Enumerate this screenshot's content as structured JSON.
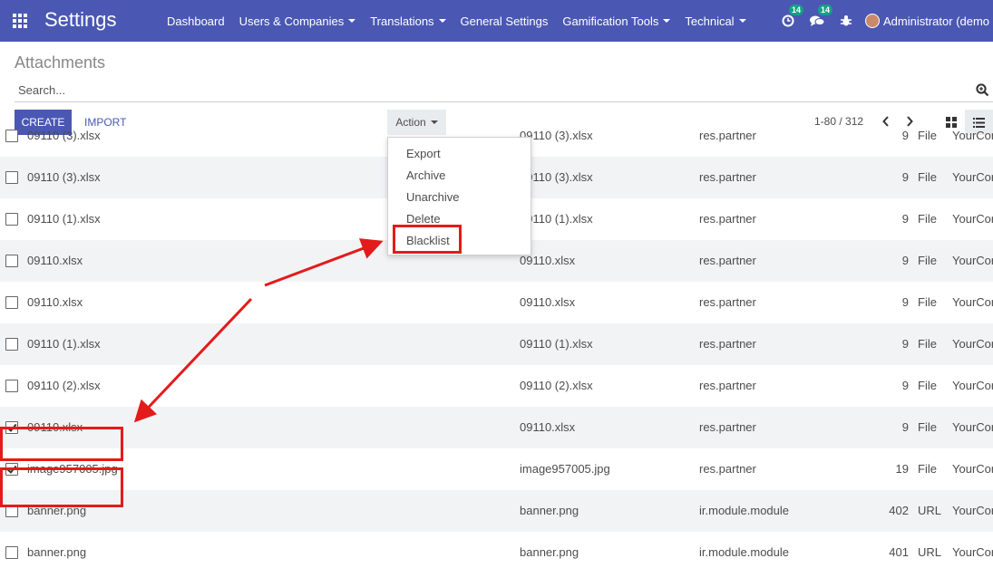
{
  "navbar": {
    "brand": "Settings",
    "menu": [
      {
        "label": "Dashboard",
        "has_caret": false
      },
      {
        "label": "Users & Companies",
        "has_caret": true
      },
      {
        "label": "Translations",
        "has_caret": true
      },
      {
        "label": "General Settings",
        "has_caret": false
      },
      {
        "label": "Gamification Tools",
        "has_caret": true
      },
      {
        "label": "Technical",
        "has_caret": true
      }
    ],
    "activity_badge": "14",
    "messages_badge": "14",
    "user": "Administrator (demo"
  },
  "control_panel": {
    "breadcrumb": "Attachments",
    "search_placeholder": "Search...",
    "create_label": "CREATE",
    "import_label": "IMPORT",
    "action_label": "Action",
    "pager": "1-80 / 312"
  },
  "action_menu": [
    "Export",
    "Archive",
    "Unarchive",
    "Delete",
    "Blacklist"
  ],
  "rows": [
    {
      "name": "09110 (3).xlsx",
      "fname": "09110 (3).xlsx",
      "model": "res.partner",
      "size": "9",
      "type": "File",
      "company": "YourCor",
      "checked": false
    },
    {
      "name": "09110 (3).xlsx",
      "fname": "09110 (3).xlsx",
      "model": "res.partner",
      "size": "9",
      "type": "File",
      "company": "YourCor",
      "checked": false
    },
    {
      "name": "09110 (1).xlsx",
      "fname": "09110 (1).xlsx",
      "model": "res.partner",
      "size": "9",
      "type": "File",
      "company": "YourCor",
      "checked": false
    },
    {
      "name": "09110.xlsx",
      "fname": "09110.xlsx",
      "model": "res.partner",
      "size": "9",
      "type": "File",
      "company": "YourCor",
      "checked": false
    },
    {
      "name": "09110.xlsx",
      "fname": "09110.xlsx",
      "model": "res.partner",
      "size": "9",
      "type": "File",
      "company": "YourCor",
      "checked": false
    },
    {
      "name": "09110 (1).xlsx",
      "fname": "09110 (1).xlsx",
      "model": "res.partner",
      "size": "9",
      "type": "File",
      "company": "YourCor",
      "checked": false
    },
    {
      "name": "09110 (2).xlsx",
      "fname": "09110 (2).xlsx",
      "model": "res.partner",
      "size": "9",
      "type": "File",
      "company": "YourCor",
      "checked": false
    },
    {
      "name": "09110.xlsx",
      "fname": "09110.xlsx",
      "model": "res.partner",
      "size": "9",
      "type": "File",
      "company": "YourCor",
      "checked": true
    },
    {
      "name": "image957005.jpg",
      "fname": "image957005.jpg",
      "model": "res.partner",
      "size": "19",
      "type": "File",
      "company": "YourCor",
      "checked": true
    },
    {
      "name": "banner.png",
      "fname": "banner.png",
      "model": "ir.module.module",
      "size": "402",
      "type": "URL",
      "company": "YourCor",
      "checked": false
    },
    {
      "name": "banner.png",
      "fname": "banner.png",
      "model": "ir.module.module",
      "size": "401",
      "type": "URL",
      "company": "YourCor",
      "checked": false
    }
  ],
  "colors": {
    "brand": "#4a58b3",
    "annotation": "#e31b1b",
    "badge": "#16a085"
  }
}
